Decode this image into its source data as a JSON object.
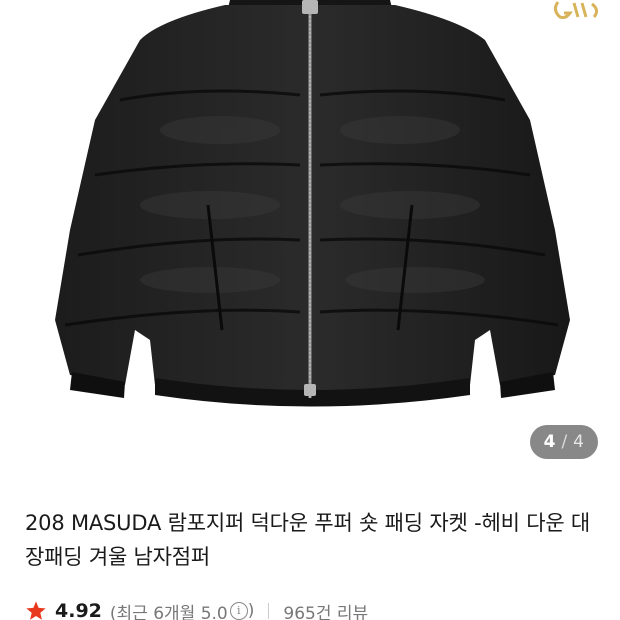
{
  "gallery": {
    "image_alt": "black puffer down jacket",
    "current_page": "4",
    "separator": "/",
    "total_pages": "4",
    "brand_icon": "brand-logo-icon"
  },
  "product": {
    "title": "208 MASUDA 람포지퍼 덕다운 푸퍼 숏 패딩 자켓 -헤비 다운 대장패딩 겨울 남자점퍼"
  },
  "rating": {
    "star_icon": "star-icon",
    "score": "4.92",
    "recent_text": "(최근 6개월 5.0",
    "info_icon": "ⓘ",
    "close_paren": ")",
    "review_count": "965건 리뷰"
  },
  "colors": {
    "star": "#e8391e",
    "badge": "#5a5a5a",
    "brand": "#d8b35a"
  }
}
